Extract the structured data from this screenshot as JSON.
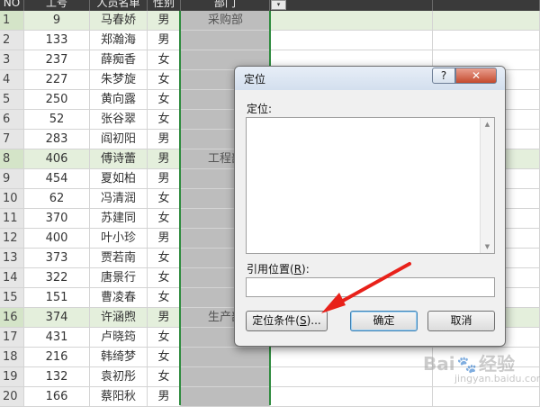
{
  "sheet": {
    "headers": {
      "no": "NO",
      "id": "工号",
      "name": "人员名单",
      "sex": "性别",
      "dept": "部门",
      "filter": "▾"
    },
    "rows": [
      {
        "no": "1",
        "id": "9",
        "name": "马春娇",
        "sex": "男",
        "dept": "采购部"
      },
      {
        "no": "2",
        "id": "133",
        "name": "郑瀚海",
        "sex": "男",
        "dept": ""
      },
      {
        "no": "3",
        "id": "237",
        "name": "薛痴香",
        "sex": "女",
        "dept": ""
      },
      {
        "no": "4",
        "id": "227",
        "name": "朱梦旋",
        "sex": "女",
        "dept": ""
      },
      {
        "no": "5",
        "id": "250",
        "name": "黄向露",
        "sex": "女",
        "dept": ""
      },
      {
        "no": "6",
        "id": "52",
        "name": "张谷翠",
        "sex": "女",
        "dept": ""
      },
      {
        "no": "7",
        "id": "283",
        "name": "阎初阳",
        "sex": "男",
        "dept": ""
      },
      {
        "no": "8",
        "id": "406",
        "name": "傅诗蕾",
        "sex": "男",
        "dept": "工程部"
      },
      {
        "no": "9",
        "id": "454",
        "name": "夏如柏",
        "sex": "男",
        "dept": ""
      },
      {
        "no": "10",
        "id": "62",
        "name": "冯清润",
        "sex": "女",
        "dept": ""
      },
      {
        "no": "11",
        "id": "370",
        "name": "苏建同",
        "sex": "女",
        "dept": ""
      },
      {
        "no": "12",
        "id": "400",
        "name": "叶小珍",
        "sex": "男",
        "dept": ""
      },
      {
        "no": "13",
        "id": "373",
        "name": "贾若南",
        "sex": "女",
        "dept": ""
      },
      {
        "no": "14",
        "id": "322",
        "name": "唐景行",
        "sex": "女",
        "dept": ""
      },
      {
        "no": "15",
        "id": "151",
        "name": "曹凌春",
        "sex": "女",
        "dept": ""
      },
      {
        "no": "16",
        "id": "374",
        "name": "许涵煦",
        "sex": "男",
        "dept": "生产部"
      },
      {
        "no": "17",
        "id": "431",
        "name": "卢晓筠",
        "sex": "女",
        "dept": ""
      },
      {
        "no": "18",
        "id": "216",
        "name": "韩绮梦",
        "sex": "女",
        "dept": ""
      },
      {
        "no": "19",
        "id": "132",
        "name": "袁初彤",
        "sex": "女",
        "dept": ""
      },
      {
        "no": "20",
        "id": "166",
        "name": "蔡阳秋",
        "sex": "男",
        "dept": ""
      }
    ]
  },
  "dialog": {
    "title": "定位",
    "help_label": "?",
    "close_label": "✕",
    "goto_label": "定位:",
    "goto_items": [],
    "reference_label": "引用位置(R):",
    "reference_value": "",
    "special_button": "定位条件(S)...",
    "ok_button": "确定",
    "cancel_button": "取消",
    "scroll_up": "▲",
    "scroll_down": "▼"
  },
  "watermark": {
    "text": "Bai",
    "paw": "🐾",
    "text2": "经验",
    "sub": "jingyan.baidu.com"
  },
  "colors": {
    "header_bg": "#3a3a3a",
    "highlight_row": "#e4efdc",
    "dept_column": "#bdbdbd",
    "separator_green": "#2e8b3e",
    "annotation_arrow": "#e8211a",
    "close_button": "#c44a2e"
  },
  "icons": {
    "annotation": "red-arrow-icon",
    "close": "close-icon",
    "help": "help-icon"
  }
}
